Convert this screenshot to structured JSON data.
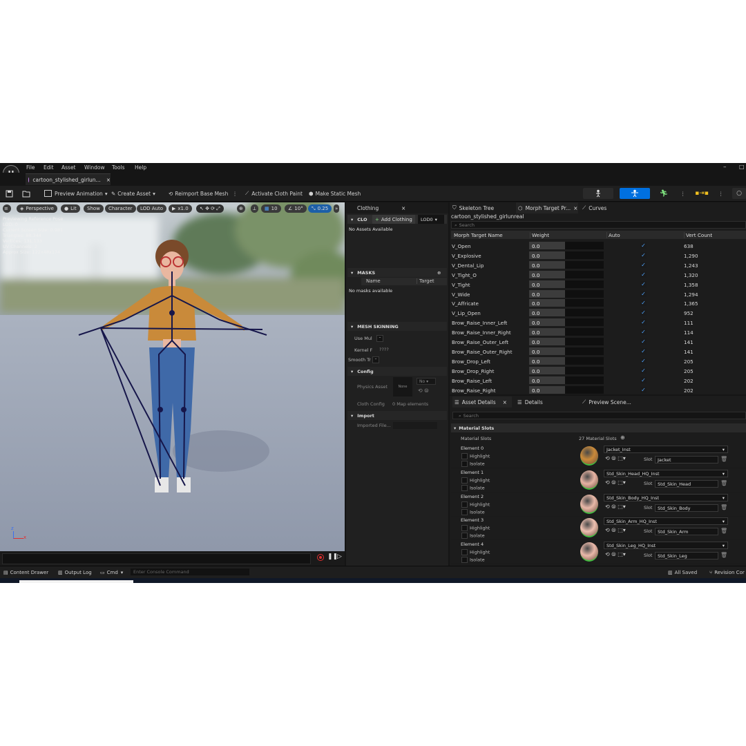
{
  "app": {
    "logo_glyph": "U"
  },
  "menu": [
    "File",
    "Edit",
    "Asset",
    "Window",
    "Tools",
    "Help"
  ],
  "doc_tab": {
    "title": "cartoon_stylished_girlun...",
    "close": "×"
  },
  "window_controls": {
    "minimize": "–",
    "maximize": "□"
  },
  "toolbar": {
    "save_icon": "save-icon",
    "preview_animation": "Preview Animation",
    "create_asset": "Create Asset",
    "reimport": "Reimport Base Mesh",
    "activate_cloth": "Activate Cloth Paint",
    "make_static": "Make Static Mesh"
  },
  "viewport": {
    "perspective": "Perspective",
    "lit": "Lit",
    "show": "Show",
    "character": "Character",
    "lod": "LOD Auto",
    "speed": "x1.0",
    "grid": "10",
    "angle": "10°",
    "scale": "0.25",
    "stats": [
      "Previewing Reference Pose",
      "LOD: 0",
      "Current Screen Size: 0.981",
      "Triangles: 88,344",
      "Vertices: 131,133",
      "UV Channels: 2",
      "Approx Size: 122x48x174"
    ],
    "axis_z": "z",
    "axis_x": "x"
  },
  "clothing_panel": {
    "tab": "Clothing",
    "close": "×",
    "section_cloth": "CLO",
    "add_clothing": "Add Clothing",
    "lod_select": "LOD0",
    "no_assets": "No Assets Available",
    "masks_header": "MASKS",
    "col_name": "Name",
    "col_target": "Target",
    "no_masks": "No masks available",
    "mesh_skinning": "MESH SKINNING",
    "use_multiple": "Use Mul",
    "kernel": "Kernel F",
    "kernel_val": "????",
    "smooth": "Smooth Tr",
    "config": "Config",
    "physics_asset": "Physics Asset",
    "physics_thumb": "None",
    "physics_select": "No",
    "cloth_config": "Cloth Config",
    "map_elements": "0 Map elements",
    "import": "Import",
    "imported_file": "Imported File..."
  },
  "morph_panel": {
    "tabs": [
      "Skeleton Tree",
      "Morph Target Pr...",
      "Curves"
    ],
    "close": "×",
    "asset_name": "cartoon_stylished_girlunreal",
    "search_placeholder": "Search",
    "columns": [
      "Morph Target Name",
      "Weight",
      "Auto",
      "Vert Count"
    ],
    "rows": [
      {
        "name": "V_Open",
        "weight": "0.0",
        "count": "638"
      },
      {
        "name": "V_Explosive",
        "weight": "0.0",
        "count": "1,290"
      },
      {
        "name": "V_Dental_Lip",
        "weight": "0.0",
        "count": "1,243"
      },
      {
        "name": "V_Tight_O",
        "weight": "0.0",
        "count": "1,320"
      },
      {
        "name": "V_Tight",
        "weight": "0.0",
        "count": "1,358"
      },
      {
        "name": "V_Wide",
        "weight": "0.0",
        "count": "1,294"
      },
      {
        "name": "V_Affricate",
        "weight": "0.0",
        "count": "1,365"
      },
      {
        "name": "V_Lip_Open",
        "weight": "0.0",
        "count": "952"
      },
      {
        "name": "Brow_Raise_Inner_Left",
        "weight": "0.0",
        "count": "111"
      },
      {
        "name": "Brow_Raise_Inner_Right",
        "weight": "0.0",
        "count": "114"
      },
      {
        "name": "Brow_Raise_Outer_Left",
        "weight": "0.0",
        "count": "141"
      },
      {
        "name": "Brow_Raise_Outer_Right",
        "weight": "0.0",
        "count": "141"
      },
      {
        "name": "Brow_Drop_Left",
        "weight": "0.0",
        "count": "205"
      },
      {
        "name": "Brow_Drop_Right",
        "weight": "0.0",
        "count": "205"
      },
      {
        "name": "Brow_Raise_Left",
        "weight": "0.0",
        "count": "202"
      },
      {
        "name": "Brow_Raise_Right",
        "weight": "0.0",
        "count": "202"
      }
    ],
    "check": "✓"
  },
  "details_panel": {
    "tabs": [
      "Asset Details",
      "Details",
      "Preview Scene..."
    ],
    "close": "×",
    "search_placeholder": "Search",
    "section": "Material Slots",
    "slots_label": "Material Slots",
    "slots_count": "27 Material Slots",
    "highlight": "Highlight",
    "isolate": "Isolate",
    "slot_label": "Slot",
    "elements": [
      {
        "label": "Element 0",
        "material": "Jacket_Inst",
        "slot": "Jacket",
        "color": "#c98a3a"
      },
      {
        "label": "Element 1",
        "material": "Std_Skin_Head_HQ_Inst",
        "slot": "Std_Skin_Head",
        "color": "#e6b3a3"
      },
      {
        "label": "Element 2",
        "material": "Std_Skin_Body_HQ_Inst",
        "slot": "Std_Skin_Body",
        "color": "#e8b8a8"
      },
      {
        "label": "Element 3",
        "material": "Std_Skin_Arm_HQ_Inst",
        "slot": "Std_Skin_Arm",
        "color": "#eec0b0"
      },
      {
        "label": "Element 4",
        "material": "Std_Skin_Leg_HQ_Inst",
        "slot": "Std_Skin_Leg",
        "color": "#eab9aa"
      }
    ]
  },
  "statusbar": {
    "content_drawer": "Content Drawer",
    "output_log": "Output Log",
    "cmd": "Cmd",
    "console_placeholder": "Enter Console Command",
    "all_saved": "All Saved",
    "revision": "Revision Cor"
  },
  "colors": {
    "accent": "#0070e0",
    "check": "#4fa3ff",
    "record": "#e03030"
  }
}
